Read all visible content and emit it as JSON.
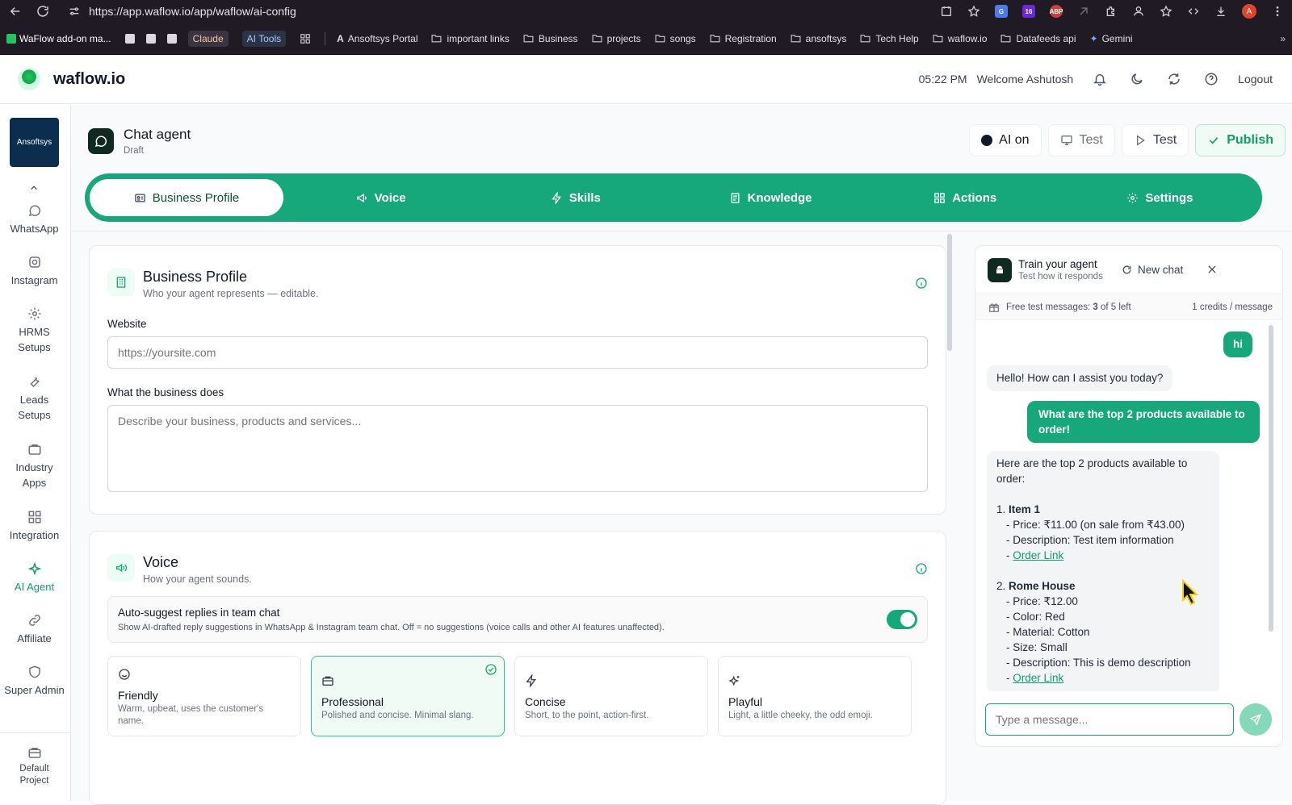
{
  "browser": {
    "url": "https://app.waflow.io/app/waflow/ai-config",
    "profile_initial": "A",
    "ext_badge": "16",
    "ext_abp": "ABP",
    "bookmarks": [
      "WaFlow add-on ma...",
      "Claude",
      "AI Tools",
      "Ansoftsys Portal",
      "important links",
      "Business",
      "projects",
      "songs",
      "Registration",
      "ansoftsys",
      "Tech Help",
      "waflow.io",
      "Datafeeds api",
      "Gemini"
    ]
  },
  "header": {
    "brand": "waflow.io",
    "time": "05:22 PM",
    "welcome": "Welcome Ashutosh",
    "logout": "Logout"
  },
  "sidebar": {
    "org_label": "Ansoftsys",
    "items": [
      {
        "label": "WhatsApp"
      },
      {
        "label": "Instagram"
      },
      {
        "label": "HRMS Setups"
      },
      {
        "label": "Leads Setups"
      },
      {
        "label": "Industry Apps"
      },
      {
        "label": "Integration"
      },
      {
        "label": "AI Agent"
      },
      {
        "label": "Affiliate"
      },
      {
        "label": "Super Admin"
      },
      {
        "label": "Default Project"
      }
    ]
  },
  "agent": {
    "title": "Chat agent",
    "status": "Draft"
  },
  "actions": {
    "ai_on": "AI on",
    "test1": "Test",
    "test2": "Test",
    "publish": "Publish"
  },
  "tabs": [
    "Business Profile",
    "Voice",
    "Skills",
    "Knowledge",
    "Actions",
    "Settings"
  ],
  "business_profile": {
    "title": "Business Profile",
    "subtitle": "Who your agent represents — editable.",
    "website_label": "Website",
    "website_placeholder": "https://yoursite.com",
    "does_label": "What the business does",
    "does_placeholder": "Describe your business, products and services..."
  },
  "voice": {
    "title": "Voice",
    "subtitle": "How your agent sounds.",
    "toggle_title": "Auto-suggest replies in team chat",
    "toggle_sub": "Show AI-drafted reply suggestions in WhatsApp & Instagram team chat. Off = no suggestions (voice calls and other AI features unaffected).",
    "tones": [
      {
        "name": "Friendly",
        "desc": "Warm, upbeat, uses the customer's name."
      },
      {
        "name": "Professional",
        "desc": "Polished and concise. Minimal slang."
      },
      {
        "name": "Concise",
        "desc": "Short, to the point, action-first."
      },
      {
        "name": "Playful",
        "desc": "Light, a little cheeky, the odd emoji."
      }
    ]
  },
  "chat": {
    "title": "Train your agent",
    "subtitle": "Test how it responds",
    "new_chat": "New chat",
    "credits_prefix": "Free test messages: ",
    "credits_used": "3",
    "credits_suffix": " of 5 left",
    "credits_rate": "1 credits / message",
    "m1": "hi",
    "m2": "Hello! How can I assist you today?",
    "m3a": "What are the top 2 products available to",
    "m3b": "order!",
    "m4": {
      "intro_a": "Here are the top 2 products available to",
      "intro_b": "order:",
      "i1_num": "1. ",
      "i1_name": "Item 1",
      "i1_price": "- Price: ₹11.00 (on sale from ₹43.00)",
      "i1_desc": "- Description: Test item information",
      "link_prefix": "- ",
      "link": "Order Link",
      "i2_num": "2. ",
      "i2_name": "Rome House",
      "i2_price": "- Price: ₹12.00",
      "i2_color": "- Color: Red",
      "i2_material": "- Material: Cotton",
      "i2_size": "- Size: Small",
      "i2_desc": "- Description: This is demo description"
    },
    "input_placeholder": "Type a message..."
  }
}
